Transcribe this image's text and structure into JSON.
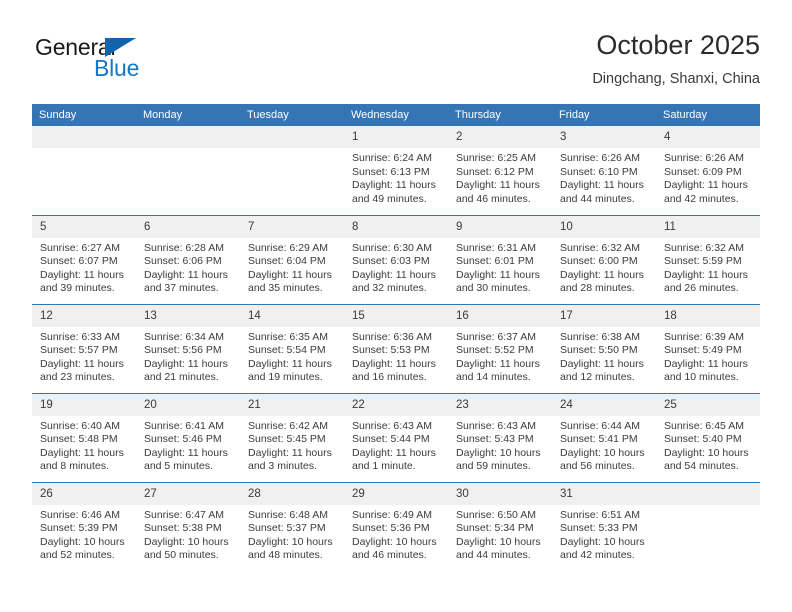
{
  "brand": {
    "name_part1": "General",
    "name_part2": "Blue",
    "triangle_color": "#1263ad",
    "blue_color": "#1577c4"
  },
  "header": {
    "title": "October 2025",
    "subtitle": "Dingchang, Shanxi, China"
  },
  "theme": {
    "header_row_bg": "#3575b6",
    "daynum_bg": "#f0f0f0",
    "grid_line": "#3575b6",
    "text": "#3c3c3c"
  },
  "weekdays": [
    "Sunday",
    "Monday",
    "Tuesday",
    "Wednesday",
    "Thursday",
    "Friday",
    "Saturday"
  ],
  "labels": {
    "sunrise": "Sunrise:",
    "sunset": "Sunset:",
    "daylight": "Daylight:"
  },
  "weeks": [
    [
      {
        "day": "",
        "empty": true
      },
      {
        "day": "",
        "empty": true
      },
      {
        "day": "",
        "empty": true
      },
      {
        "day": "1",
        "sunrise": "Sunrise: 6:24 AM",
        "sunset": "Sunset: 6:13 PM",
        "daylight_1": "Daylight: 11 hours",
        "daylight_2": "and 49 minutes."
      },
      {
        "day": "2",
        "sunrise": "Sunrise: 6:25 AM",
        "sunset": "Sunset: 6:12 PM",
        "daylight_1": "Daylight: 11 hours",
        "daylight_2": "and 46 minutes."
      },
      {
        "day": "3",
        "sunrise": "Sunrise: 6:26 AM",
        "sunset": "Sunset: 6:10 PM",
        "daylight_1": "Daylight: 11 hours",
        "daylight_2": "and 44 minutes."
      },
      {
        "day": "4",
        "sunrise": "Sunrise: 6:26 AM",
        "sunset": "Sunset: 6:09 PM",
        "daylight_1": "Daylight: 11 hours",
        "daylight_2": "and 42 minutes."
      }
    ],
    [
      {
        "day": "5",
        "sunrise": "Sunrise: 6:27 AM",
        "sunset": "Sunset: 6:07 PM",
        "daylight_1": "Daylight: 11 hours",
        "daylight_2": "and 39 minutes."
      },
      {
        "day": "6",
        "sunrise": "Sunrise: 6:28 AM",
        "sunset": "Sunset: 6:06 PM",
        "daylight_1": "Daylight: 11 hours",
        "daylight_2": "and 37 minutes."
      },
      {
        "day": "7",
        "sunrise": "Sunrise: 6:29 AM",
        "sunset": "Sunset: 6:04 PM",
        "daylight_1": "Daylight: 11 hours",
        "daylight_2": "and 35 minutes."
      },
      {
        "day": "8",
        "sunrise": "Sunrise: 6:30 AM",
        "sunset": "Sunset: 6:03 PM",
        "daylight_1": "Daylight: 11 hours",
        "daylight_2": "and 32 minutes."
      },
      {
        "day": "9",
        "sunrise": "Sunrise: 6:31 AM",
        "sunset": "Sunset: 6:01 PM",
        "daylight_1": "Daylight: 11 hours",
        "daylight_2": "and 30 minutes."
      },
      {
        "day": "10",
        "sunrise": "Sunrise: 6:32 AM",
        "sunset": "Sunset: 6:00 PM",
        "daylight_1": "Daylight: 11 hours",
        "daylight_2": "and 28 minutes."
      },
      {
        "day": "11",
        "sunrise": "Sunrise: 6:32 AM",
        "sunset": "Sunset: 5:59 PM",
        "daylight_1": "Daylight: 11 hours",
        "daylight_2": "and 26 minutes."
      }
    ],
    [
      {
        "day": "12",
        "sunrise": "Sunrise: 6:33 AM",
        "sunset": "Sunset: 5:57 PM",
        "daylight_1": "Daylight: 11 hours",
        "daylight_2": "and 23 minutes."
      },
      {
        "day": "13",
        "sunrise": "Sunrise: 6:34 AM",
        "sunset": "Sunset: 5:56 PM",
        "daylight_1": "Daylight: 11 hours",
        "daylight_2": "and 21 minutes."
      },
      {
        "day": "14",
        "sunrise": "Sunrise: 6:35 AM",
        "sunset": "Sunset: 5:54 PM",
        "daylight_1": "Daylight: 11 hours",
        "daylight_2": "and 19 minutes."
      },
      {
        "day": "15",
        "sunrise": "Sunrise: 6:36 AM",
        "sunset": "Sunset: 5:53 PM",
        "daylight_1": "Daylight: 11 hours",
        "daylight_2": "and 16 minutes."
      },
      {
        "day": "16",
        "sunrise": "Sunrise: 6:37 AM",
        "sunset": "Sunset: 5:52 PM",
        "daylight_1": "Daylight: 11 hours",
        "daylight_2": "and 14 minutes."
      },
      {
        "day": "17",
        "sunrise": "Sunrise: 6:38 AM",
        "sunset": "Sunset: 5:50 PM",
        "daylight_1": "Daylight: 11 hours",
        "daylight_2": "and 12 minutes."
      },
      {
        "day": "18",
        "sunrise": "Sunrise: 6:39 AM",
        "sunset": "Sunset: 5:49 PM",
        "daylight_1": "Daylight: 11 hours",
        "daylight_2": "and 10 minutes."
      }
    ],
    [
      {
        "day": "19",
        "sunrise": "Sunrise: 6:40 AM",
        "sunset": "Sunset: 5:48 PM",
        "daylight_1": "Daylight: 11 hours",
        "daylight_2": "and 8 minutes."
      },
      {
        "day": "20",
        "sunrise": "Sunrise: 6:41 AM",
        "sunset": "Sunset: 5:46 PM",
        "daylight_1": "Daylight: 11 hours",
        "daylight_2": "and 5 minutes."
      },
      {
        "day": "21",
        "sunrise": "Sunrise: 6:42 AM",
        "sunset": "Sunset: 5:45 PM",
        "daylight_1": "Daylight: 11 hours",
        "daylight_2": "and 3 minutes."
      },
      {
        "day": "22",
        "sunrise": "Sunrise: 6:43 AM",
        "sunset": "Sunset: 5:44 PM",
        "daylight_1": "Daylight: 11 hours",
        "daylight_2": "and 1 minute."
      },
      {
        "day": "23",
        "sunrise": "Sunrise: 6:43 AM",
        "sunset": "Sunset: 5:43 PM",
        "daylight_1": "Daylight: 10 hours",
        "daylight_2": "and 59 minutes."
      },
      {
        "day": "24",
        "sunrise": "Sunrise: 6:44 AM",
        "sunset": "Sunset: 5:41 PM",
        "daylight_1": "Daylight: 10 hours",
        "daylight_2": "and 56 minutes."
      },
      {
        "day": "25",
        "sunrise": "Sunrise: 6:45 AM",
        "sunset": "Sunset: 5:40 PM",
        "daylight_1": "Daylight: 10 hours",
        "daylight_2": "and 54 minutes."
      }
    ],
    [
      {
        "day": "26",
        "sunrise": "Sunrise: 6:46 AM",
        "sunset": "Sunset: 5:39 PM",
        "daylight_1": "Daylight: 10 hours",
        "daylight_2": "and 52 minutes."
      },
      {
        "day": "27",
        "sunrise": "Sunrise: 6:47 AM",
        "sunset": "Sunset: 5:38 PM",
        "daylight_1": "Daylight: 10 hours",
        "daylight_2": "and 50 minutes."
      },
      {
        "day": "28",
        "sunrise": "Sunrise: 6:48 AM",
        "sunset": "Sunset: 5:37 PM",
        "daylight_1": "Daylight: 10 hours",
        "daylight_2": "and 48 minutes."
      },
      {
        "day": "29",
        "sunrise": "Sunrise: 6:49 AM",
        "sunset": "Sunset: 5:36 PM",
        "daylight_1": "Daylight: 10 hours",
        "daylight_2": "and 46 minutes."
      },
      {
        "day": "30",
        "sunrise": "Sunrise: 6:50 AM",
        "sunset": "Sunset: 5:34 PM",
        "daylight_1": "Daylight: 10 hours",
        "daylight_2": "and 44 minutes."
      },
      {
        "day": "31",
        "sunrise": "Sunrise: 6:51 AM",
        "sunset": "Sunset: 5:33 PM",
        "daylight_1": "Daylight: 10 hours",
        "daylight_2": "and 42 minutes."
      },
      {
        "day": "",
        "empty": true
      }
    ]
  ]
}
